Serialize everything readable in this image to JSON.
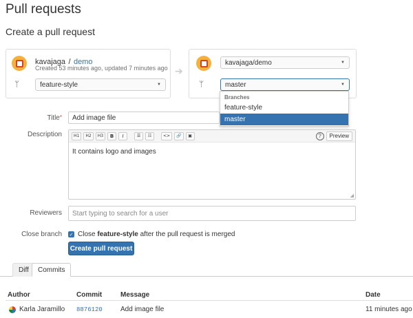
{
  "page": {
    "title": "Pull requests",
    "subtitle": "Create a pull request"
  },
  "source": {
    "owner": "kavajaga",
    "separator": "/",
    "repo": "demo",
    "meta": "Created 53 minutes ago, updated 7 minutes ago",
    "branch": "feature-style"
  },
  "destination": {
    "repo": "kavajaga/demo",
    "branch": "master",
    "dropdown": {
      "header": "Branches",
      "options": [
        "feature-style",
        "master"
      ],
      "selected": "master"
    }
  },
  "form": {
    "title_label": "Title",
    "title_required": "*",
    "title_value": "Add image file",
    "description_label": "Description",
    "description_value": "It contains logo and images",
    "toolbar": {
      "h1": "H1",
      "h2": "H2",
      "h3": "H3",
      "bold": "B",
      "italic": "I",
      "bullets": "☰",
      "numbers": "☷",
      "code": "<>",
      "link": "🔗",
      "image": "▣",
      "help": "?",
      "preview": "Preview"
    },
    "reviewers_label": "Reviewers",
    "reviewers_placeholder": "Start typing to search for a user",
    "close_branch_label": "Close branch",
    "close_branch_text_before": "Close",
    "close_branch_branch": "feature-style",
    "close_branch_text_after": "after the pull request is merged",
    "close_branch_checked": true,
    "submit_label": "Create pull request"
  },
  "tabs": [
    {
      "label": "Diff",
      "active": false
    },
    {
      "label": "Commits",
      "active": true
    }
  ],
  "commits": {
    "headers": [
      "Author",
      "Commit",
      "Message",
      "Date"
    ],
    "rows": [
      {
        "author": "Karla Jaramillo",
        "commit": "8876120",
        "message": "Add image file",
        "date": "11 minutes ago"
      }
    ]
  },
  "colors": {
    "accent": "#3572b0",
    "required": "#d04437"
  }
}
